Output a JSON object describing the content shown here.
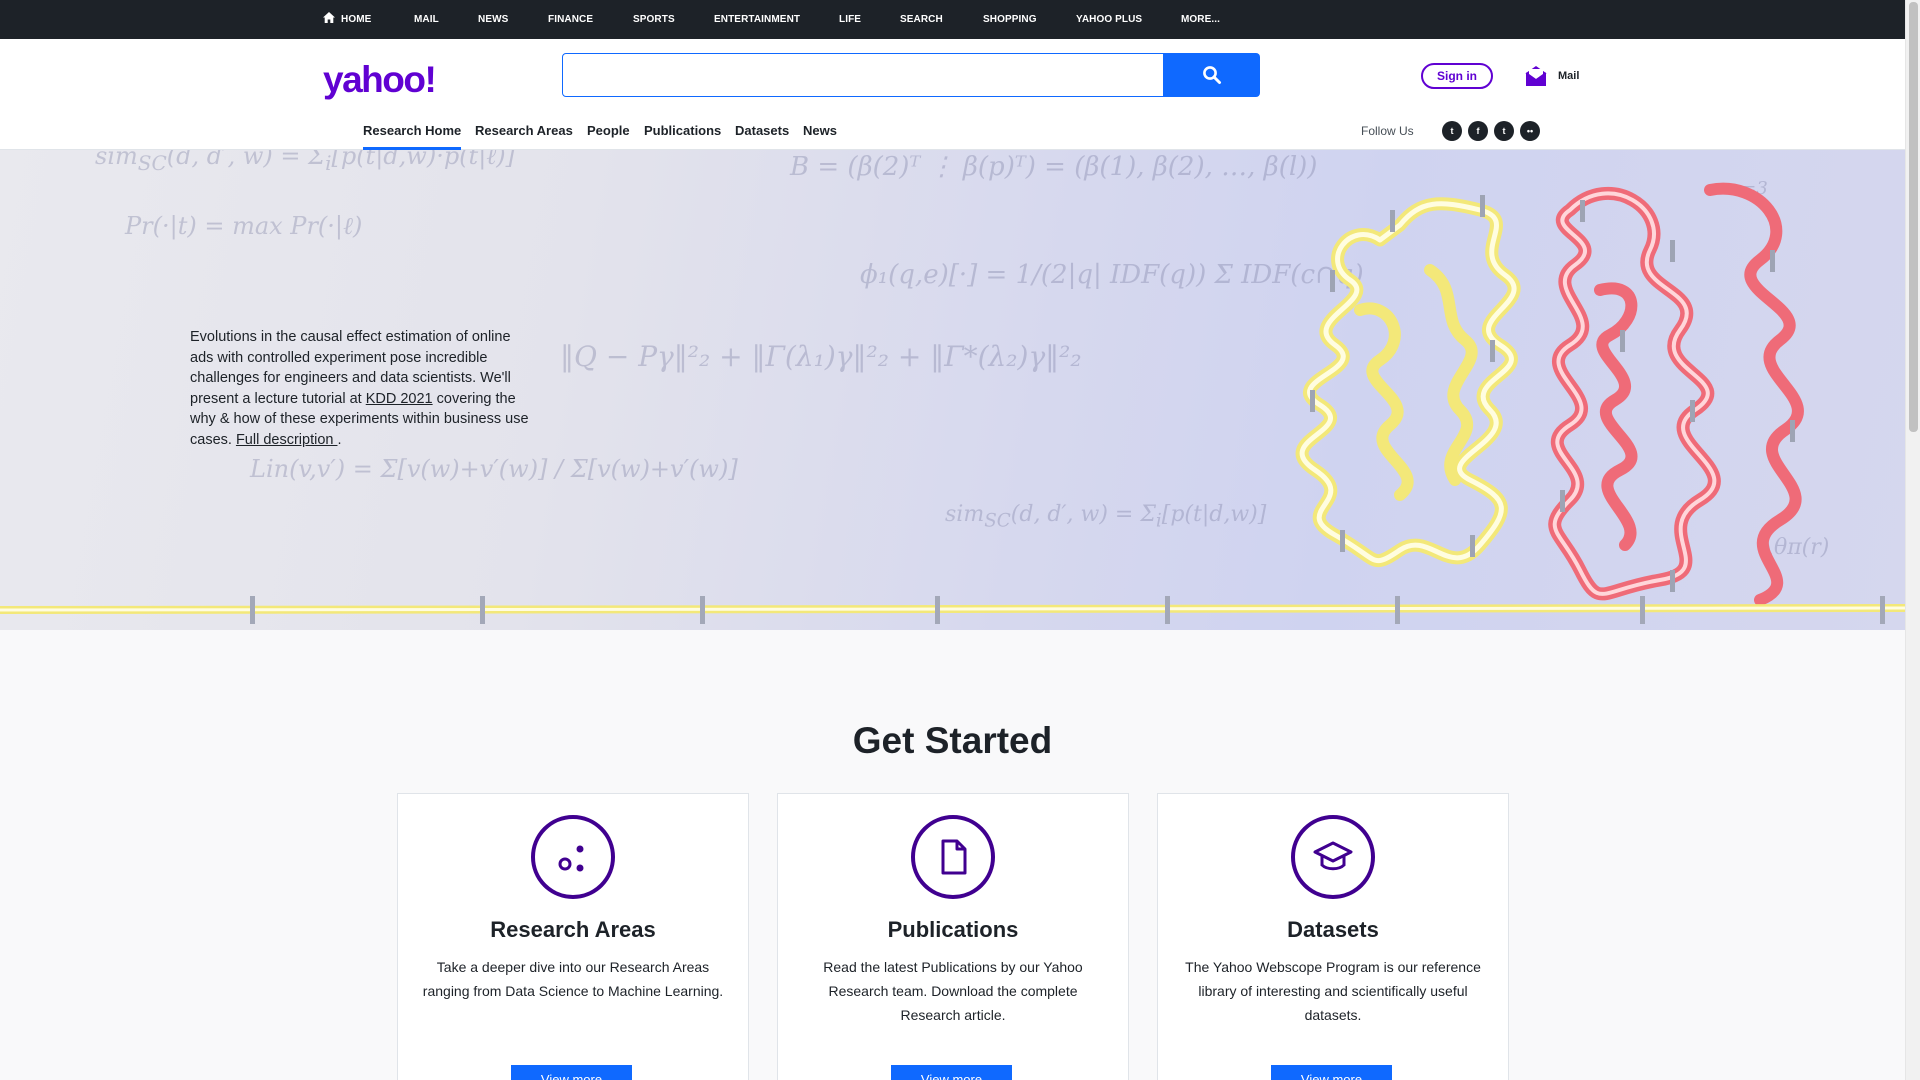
{
  "topnav": {
    "items": [
      "HOME",
      "MAIL",
      "NEWS",
      "FINANCE",
      "SPORTS",
      "ENTERTAINMENT",
      "LIFE",
      "SEARCH",
      "SHOPPING",
      "YAHOO PLUS",
      "MORE..."
    ]
  },
  "header": {
    "logo": "yahoo!",
    "search_value": "",
    "signin_label": "Sign in",
    "mail_label": "Mail"
  },
  "subnav": {
    "tabs": [
      "Research Home",
      "Research Areas",
      "People",
      "Publications",
      "Datasets",
      "News"
    ],
    "active": "Research Home",
    "follow_label": "Follow Us",
    "social": [
      {
        "name": "twitter-icon",
        "glyph": "t"
      },
      {
        "name": "facebook-icon",
        "glyph": "f"
      },
      {
        "name": "tumblr-icon",
        "glyph": "t"
      },
      {
        "name": "flickr-icon",
        "glyph": "••"
      }
    ]
  },
  "hero": {
    "text_before": "Evolutions in the causal effect estimation of online ads with controlled experiment pose incredible challenges for engineers and data scientists. We'll present a lecture tutorial at ",
    "link1": "KDD 2021",
    "text_mid": " covering the why & how of these experiments within business use cases. ",
    "link2": "Full description ",
    "text_after": "."
  },
  "get_started": {
    "title": "Get Started",
    "cards": [
      {
        "title": "Research Areas",
        "desc": "Take a deeper dive into our Research Areas ranging from Data Science to Machine Learning.",
        "button": "View more"
      },
      {
        "title": "Publications",
        "desc": "Read the latest Publications by our Yahoo Research team. Download the complete Research article.",
        "button": "View more"
      },
      {
        "title": "Datasets",
        "desc": "The Yahoo Webscope Program is our reference library of interesting and scientifically useful datasets.",
        "button": "View more"
      }
    ]
  },
  "colors": {
    "brand": "#6001d2",
    "accent": "#0f69ff",
    "topbar": "#1d2228"
  }
}
